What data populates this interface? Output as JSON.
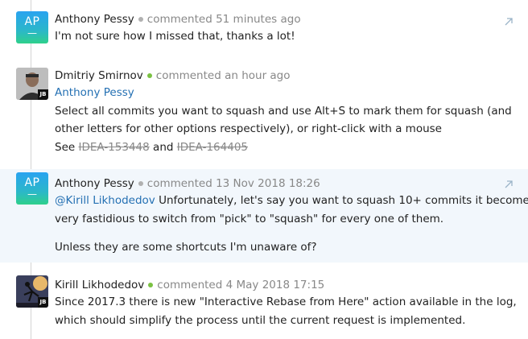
{
  "comments": [
    {
      "author": "Anthony Pessy",
      "avatar_initials": "AP",
      "status": "offline",
      "verb": "commented",
      "time": "51 minutes ago",
      "lines": [
        "I'm not sure how I missed that, thanks a lot!"
      ]
    },
    {
      "author": "Dmitriy Smirnov",
      "avatar_badge": "JB",
      "status": "online",
      "verb": "commented",
      "time": "an hour ago",
      "reply_to": "Anthony Pessy",
      "lines": [
        "Select all commits you want to squash and use Alt+S to mark them for squash (and",
        "other letters for other options respectively), or right-click with a mouse"
      ],
      "see_prefix": "See",
      "links": [
        "IDEA-153448",
        "IDEA-164405"
      ],
      "and_word": "and"
    },
    {
      "author": "Anthony Pessy",
      "avatar_initials": "AP",
      "status": "offline",
      "verb": "commented",
      "time": "13 Nov 2018 18:26",
      "mention": "@Kirill Likhodedov",
      "lines": [
        " Unfortunately, let's say you want to squash 10+ commits it become",
        "very fastidious to switch from \"pick\" to \"squash\" for every one of them."
      ],
      "paragraph2": "Unless they are some shortcuts I'm unaware of?"
    },
    {
      "author": "Kirill Likhodedov",
      "avatar_badge": "JB",
      "status": "online",
      "verb": "commented",
      "time": "4 May 2018 17:15",
      "lines": [
        "Since 2017.3 there is new \"Interactive Rebase from Here\" action available in the log,",
        "which should simplify the process until the current request is implemented."
      ]
    }
  ]
}
